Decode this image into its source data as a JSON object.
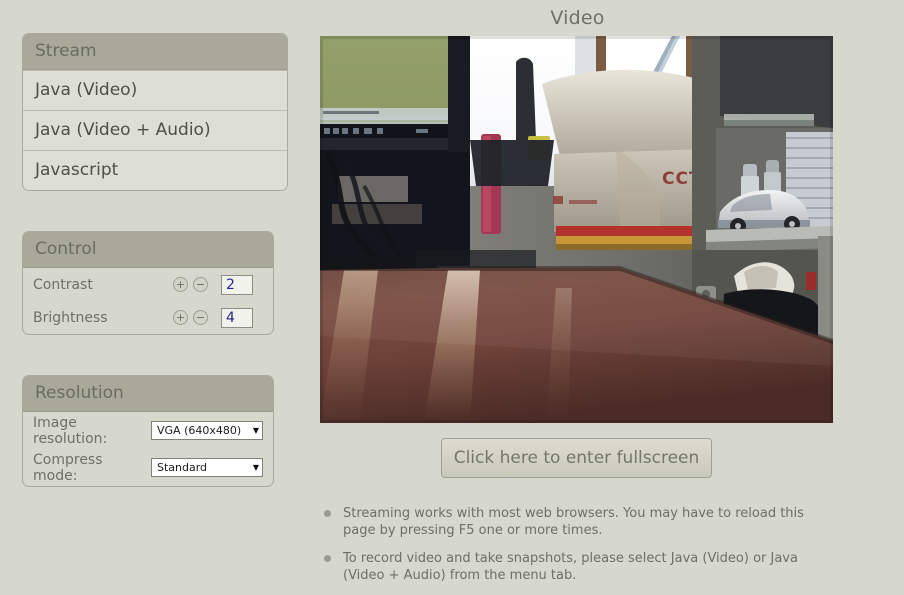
{
  "page": {
    "title": "Video",
    "background_color": "#d7d8cd",
    "accent_color": "#a8a99b"
  },
  "stream_panel": {
    "header": "Stream",
    "items": [
      {
        "label": "Java (Video)"
      },
      {
        "label": "Java (Video + Audio)"
      },
      {
        "label": "Javascript"
      }
    ]
  },
  "control_panel": {
    "header": "Control",
    "increment_icon": "plus-icon",
    "decrement_icon": "minus-icon",
    "increment_label": "+",
    "decrement_label": "−",
    "rows": [
      {
        "label": "Contrast",
        "value": "2"
      },
      {
        "label": "Brightness",
        "value": "4"
      }
    ]
  },
  "resolution_panel": {
    "header": "Resolution",
    "arrow_glyph": "▼",
    "rows": [
      {
        "label": "Image resolution:",
        "value": "VGA (640x480)"
      },
      {
        "label": "Compress mode:",
        "value": "Standard"
      }
    ]
  },
  "video": {
    "alt": "Live camera view of a desk with monitor, pen holder, CCTV box, window and shelf with model car",
    "fullscreen_button": "Click here to enter fullscreen"
  },
  "notes": [
    "Streaming works with most web browsers. You may have to reload this page by pressing F5 one or more times.",
    "To record video and take snapshots, please select Java (Video) or Java (Video + Audio) from the menu tab."
  ]
}
